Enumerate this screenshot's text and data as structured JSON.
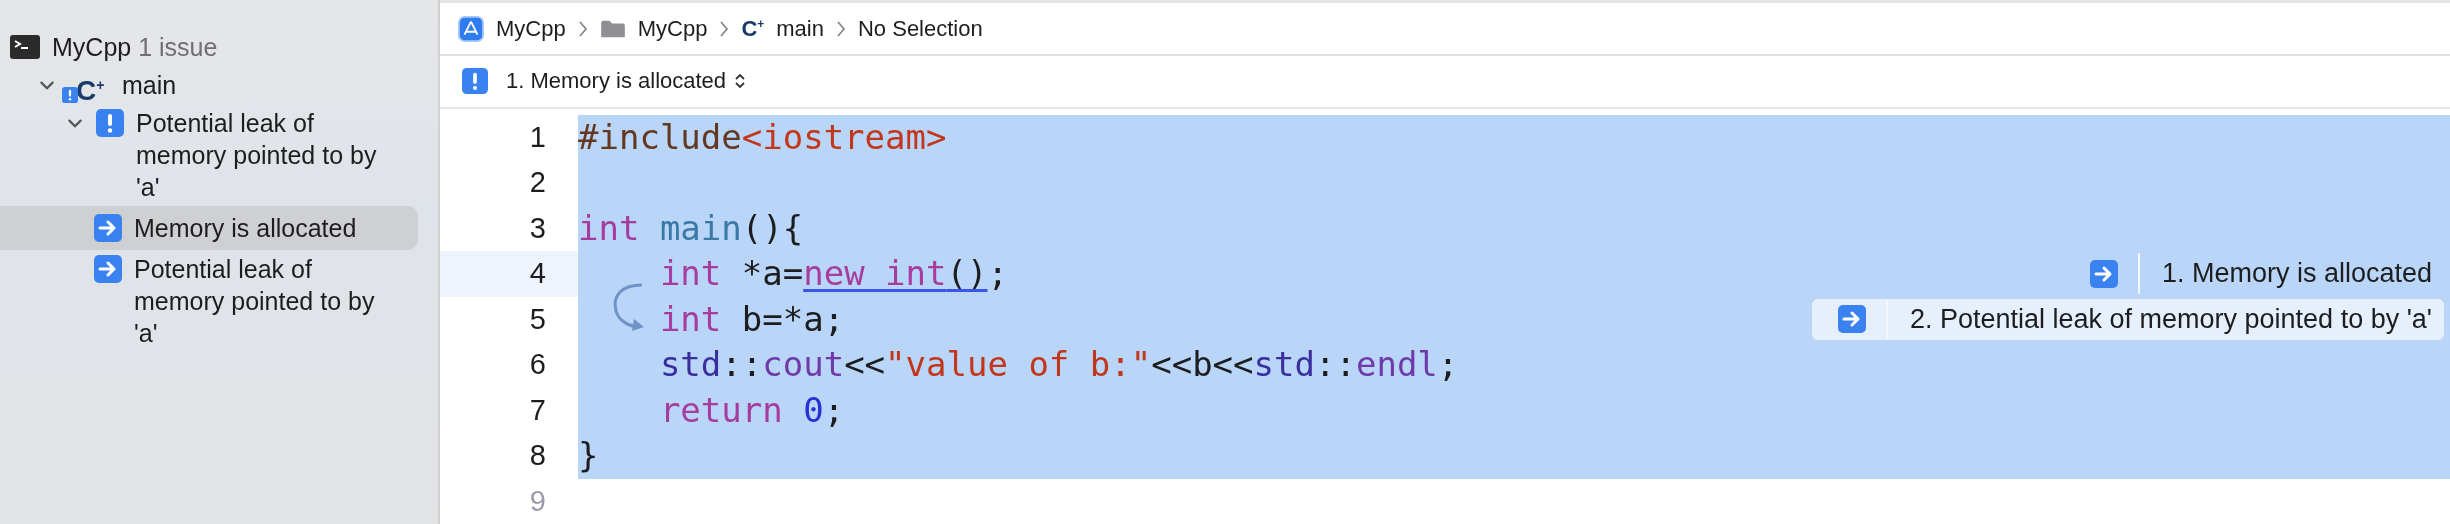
{
  "sidebar": {
    "tree": [
      {
        "kind": "project",
        "label": "MyCpp",
        "detail": "1 issue",
        "children": [
          {
            "kind": "function",
            "icon_text": "C$^{+}$",
            "label": "main",
            "expanded": true,
            "children": [
              {
                "kind": "issue",
                "label": "Potential leak of memory pointed to by 'a'",
                "expanded": true,
                "children": [
                  {
                    "kind": "step",
                    "label": "Memory is allocated",
                    "selected": true
                  },
                  {
                    "kind": "step",
                    "label": "Potential leak of memory pointed to by 'a'",
                    "selected": false
                  }
                ]
              }
            ]
          }
        ]
      }
    ]
  },
  "breadcrumb": [
    {
      "kind": "app",
      "label": "MyCpp"
    },
    {
      "kind": "folder",
      "label": "MyCpp"
    },
    {
      "kind": "source",
      "icon_text": "C$^{+}$",
      "label": "main"
    },
    {
      "kind": "plain",
      "label": "No Selection"
    }
  ],
  "issue_bar": {
    "label": "1. Memory is allocated"
  },
  "editor": {
    "lines": [
      {
        "number": "1",
        "selected": true,
        "current": false,
        "indented": false,
        "tokens": [
          {
            "text": "#include",
            "kind": "preproc"
          },
          {
            "text": "<iostream>",
            "kind": "string"
          }
        ]
      },
      {
        "number": "2",
        "selected": true,
        "current": false
      },
      {
        "number": "3",
        "selected": true,
        "current": false,
        "indented": false,
        "tokens": [
          {
            "text": "int",
            "kind": "keyword"
          },
          {
            "text": " main",
            "kind": "function"
          },
          {
            "text": "(){",
            "kind": "plain"
          }
        ]
      },
      {
        "number": "4",
        "selected": true,
        "current": true,
        "indented": true,
        "tokens": [
          {
            "text": "int",
            "kind": "keyword",
            "underlined": false
          },
          {
            "text": " *a=",
            "kind": "plain",
            "underlined": false
          },
          {
            "text": "new int",
            "kind": "keyword",
            "underlined": true
          },
          {
            "text": "()",
            "kind": "plain",
            "underlined": true
          },
          {
            "text": ";",
            "kind": "plain",
            "underlined": false
          }
        ],
        "annotation": {
          "text": "1. Memory is allocated",
          "highlighted": false
        }
      },
      {
        "number": "5",
        "selected": true,
        "current": false,
        "indented": true,
        "tokens": [
          {
            "text": "int",
            "kind": "keyword"
          },
          {
            "text": " b=*a;",
            "kind": "plain"
          }
        ],
        "annotation": {
          "text": "2. Potential leak of memory pointed to by 'a'",
          "highlighted": true
        }
      },
      {
        "number": "6",
        "selected": true,
        "current": false,
        "indented": true,
        "tokens": [
          {
            "text": "std",
            "kind": "namespace"
          },
          {
            "text": "::",
            "kind": "plain"
          },
          {
            "text": "cout",
            "kind": "member"
          },
          {
            "text": "<<",
            "kind": "plain"
          },
          {
            "text": "\"value of b:\"",
            "kind": "string"
          },
          {
            "text": "<<b<<",
            "kind": "plain"
          },
          {
            "text": "std",
            "kind": "namespace"
          },
          {
            "text": "::",
            "kind": "plain"
          },
          {
            "text": "endl",
            "kind": "member"
          },
          {
            "text": ";",
            "kind": "plain"
          }
        ]
      },
      {
        "number": "7",
        "selected": true,
        "current": false,
        "indented": true,
        "tokens": [
          {
            "text": "return",
            "kind": "keyword"
          },
          {
            "text": " 0",
            "kind": "number"
          },
          {
            "text": ";",
            "kind": "plain"
          }
        ]
      },
      {
        "number": "8",
        "selected": true,
        "current": false,
        "indented": false,
        "tokens": [
          {
            "text": "}",
            "kind": "plain"
          }
        ]
      },
      {
        "number": "9",
        "selected": false,
        "current": false
      }
    ]
  }
}
